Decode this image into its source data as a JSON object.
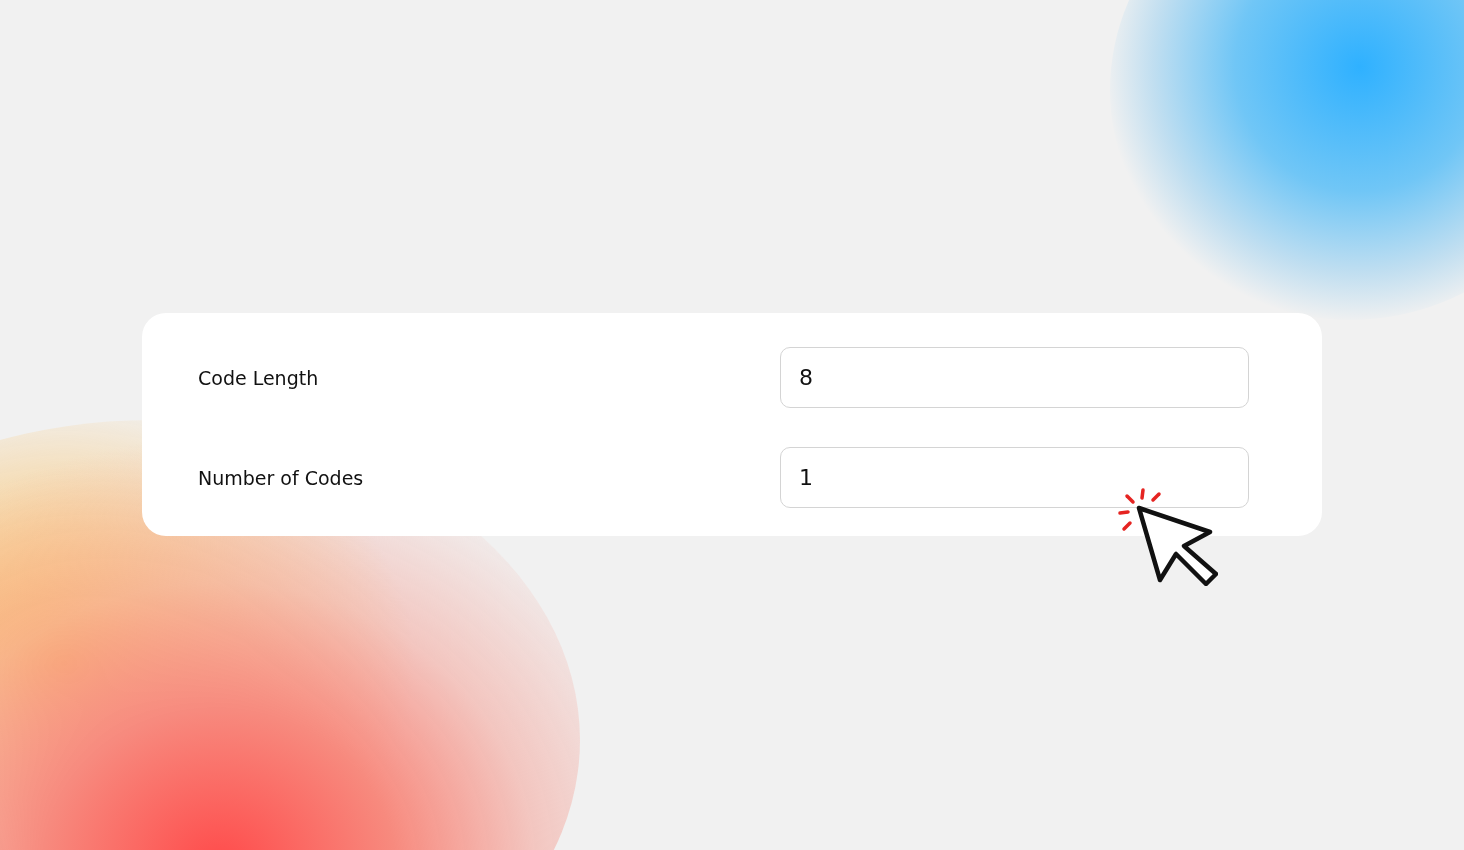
{
  "fields": [
    {
      "label": "Code Length",
      "value": "8"
    },
    {
      "label": "Number of Codes",
      "value": "1"
    }
  ]
}
